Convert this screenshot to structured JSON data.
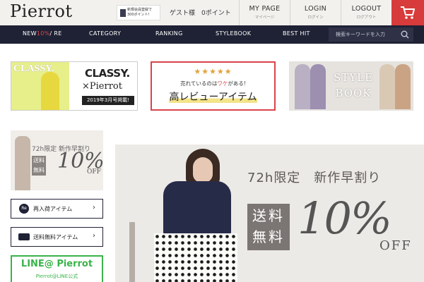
{
  "header": {
    "logo": "Pierrot",
    "promo": {
      "line1": "新規会員登録で",
      "line2": "300ポイント！"
    },
    "guest": "ゲスト様　0ポイント",
    "nav": [
      {
        "label": "MY PAGE",
        "sub": "マイページ"
      },
      {
        "label": "LOGIN",
        "sub": "ログイン"
      },
      {
        "label": "LOGOUT",
        "sub": "ログアウト"
      }
    ],
    "cart_icon": "cart-icon"
  },
  "category_nav": {
    "new_label_prefix": "NEW",
    "new_label_highlight": "10%",
    "new_label_suffix": "/ RE",
    "items": [
      "CATEGORY",
      "RANKING",
      "STYLEBOOK",
      "BEST HIT"
    ],
    "search_placeholder": "検索キーワードを入力",
    "search_icon": "search-icon"
  },
  "banners": {
    "classy": {
      "magazine": "CLASSY.",
      "brand": "CLASSY.",
      "collab": "×Pierrot",
      "issue": "2019年3月号掲載!"
    },
    "review": {
      "stars": "★★★★★",
      "sub_prefix": "売れているのは",
      "sub_highlight": "ワケ",
      "sub_suffix": "がある!",
      "main": "高レビューアイテム"
    },
    "stylebook": {
      "line1": "STYLE",
      "line2": "BOOK"
    }
  },
  "sidebar": {
    "ad": {
      "title": "72h限定 新作早割り",
      "box_line1": "送料",
      "box_line2": "無料",
      "percent": "10%",
      "off": "OFF"
    },
    "buttons": [
      {
        "icon_text": "Re",
        "label": "再入荷アイテム",
        "chevron": "›"
      },
      {
        "label": "送料無料アイテム",
        "chevron": "›"
      }
    ],
    "line": {
      "title": "LINE@ Pierrot",
      "sub": "Pierrot@LINE公式"
    }
  },
  "hero": {
    "title": "72h限定　新作早割り",
    "box_line1": "送料",
    "box_line2": "無料",
    "percent": "10%",
    "off": "OFF"
  },
  "colors": {
    "nav_bg": "#1f2235",
    "cart_bg": "#d83b3b",
    "accent_red": "#e0464b",
    "line_green": "#3ab34a"
  }
}
